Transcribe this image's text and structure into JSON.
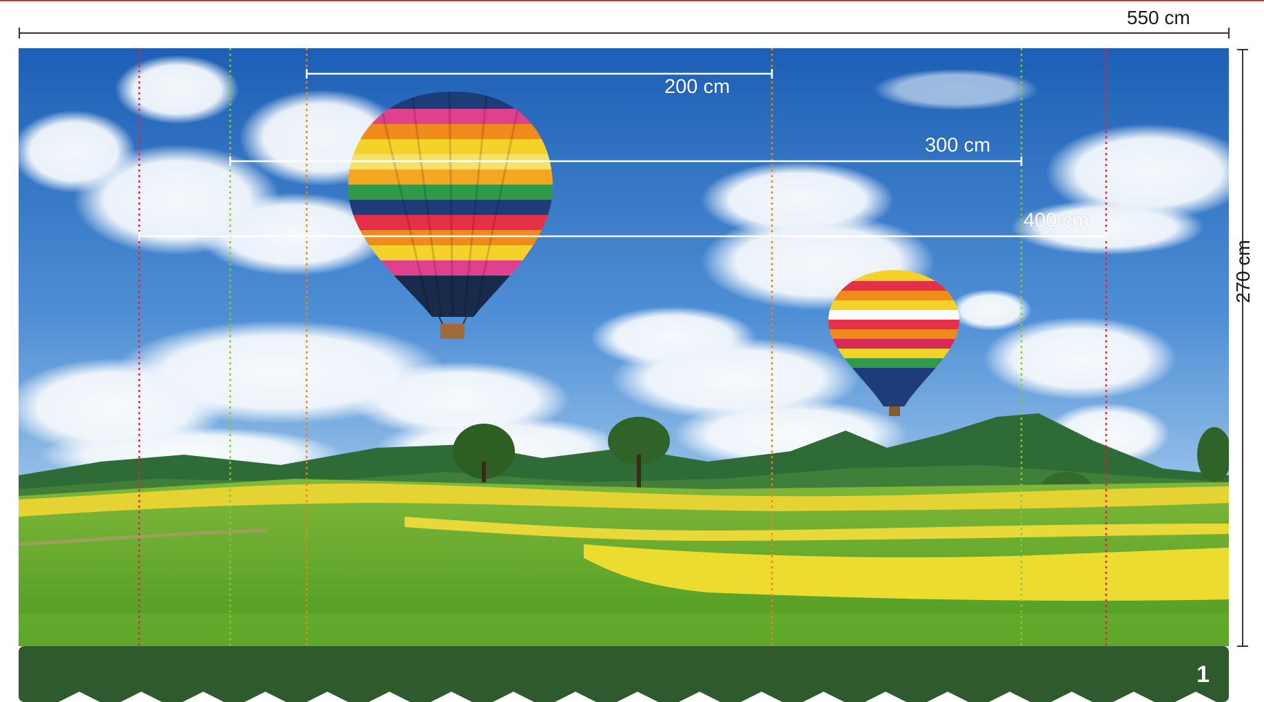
{
  "dimensions": {
    "width_label": "550 cm",
    "height_label": "270 cm"
  },
  "measurements": [
    {
      "label": "200 cm",
      "color": "#e08a1e"
    },
    {
      "label": "300 cm",
      "color": "#8cc63f"
    },
    {
      "label": "400 cm",
      "color": "#d7263d"
    }
  ],
  "panel": {
    "number": "1",
    "band_color": "#2e5a2e"
  },
  "colors": {
    "accent_line": "#c4373f",
    "sky_top": "#1e62b8",
    "field_green": "#5fa62a",
    "flowers_yellow": "#e8d62a"
  }
}
